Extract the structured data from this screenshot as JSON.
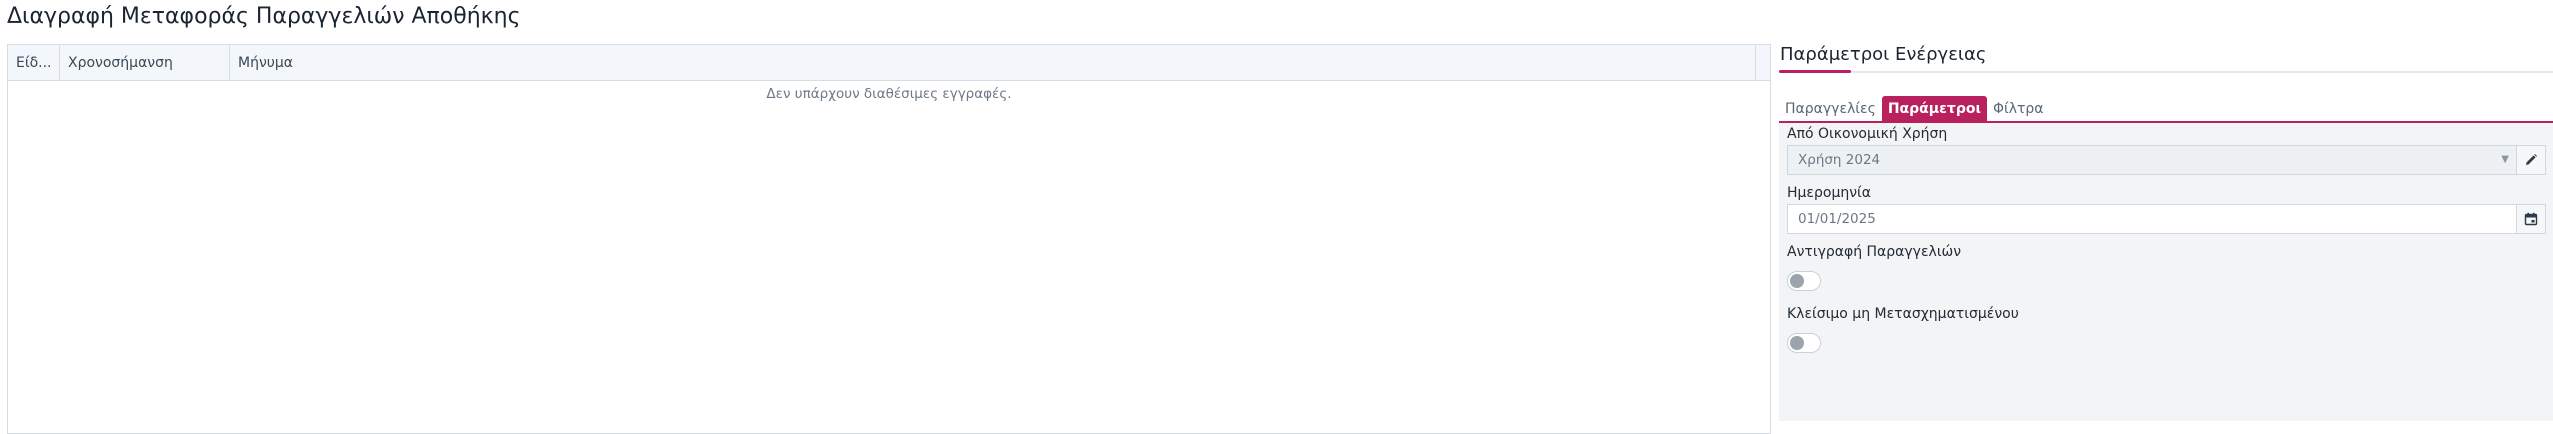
{
  "page": {
    "title": "Διαγραφή Μεταφοράς Παραγγελιών Αποθήκης"
  },
  "grid": {
    "columns": [
      "Είδ...",
      "Χρονοσήμανση",
      "Μήνυμα"
    ],
    "empty_text": "Δεν υπάρχουν διαθέσιμες εγγραφές."
  },
  "panel": {
    "title": "Παράμετροι Ενέργειας",
    "accent_color": "#b8205e",
    "tabs": [
      {
        "label": "Παραγγελίες",
        "active": false
      },
      {
        "label": "Παράμετροι",
        "active": true
      },
      {
        "label": "Φίλτρα",
        "active": false
      }
    ],
    "fields": {
      "fiscal_year": {
        "label": "Από Οικονομική Χρήση",
        "value": "Χρήση 2024"
      },
      "date": {
        "label": "Ημερομηνία",
        "value": "01/01/2025"
      },
      "copy_orders": {
        "label": "Αντιγραφή Παραγγελιών",
        "checked": false
      },
      "close_untransformed": {
        "label": "Κλείσιμο μη Μετασχηματισμένου",
        "checked": false
      }
    }
  }
}
